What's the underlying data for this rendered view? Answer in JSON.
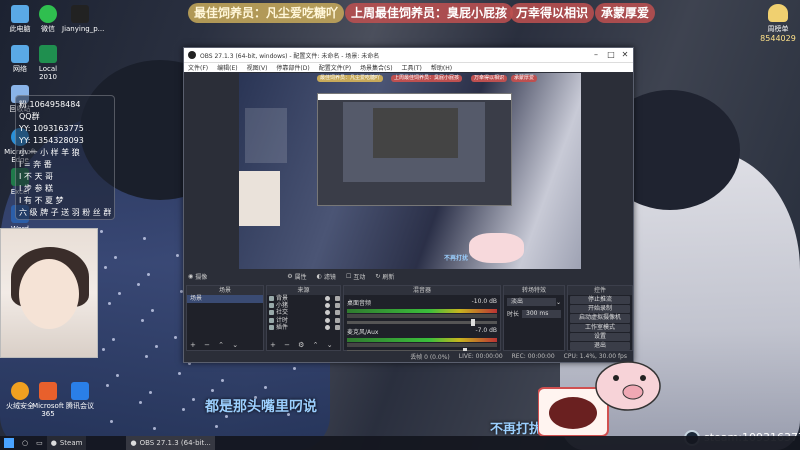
{
  "banners": {
    "best_feeder": "最佳饲养员：凡尘爱吃糖吖",
    "last_week": "上周最佳饲养员：臭屁小屁孩",
    "thanks": "万幸得以相识",
    "grateful": "承蒙厚爱"
  },
  "desktop_icons": [
    {
      "label": "此电脑",
      "color": "#5aa9e6"
    },
    {
      "label": "微信",
      "color": "#2fbf4f"
    },
    {
      "label": "Jianying_p...",
      "color": "#222222"
    },
    {
      "label": "网络",
      "color": "#5aa9e6"
    },
    {
      "label": "Local 2010",
      "color": "#1f8f4f"
    },
    {
      "label": "回收站",
      "color": "#8ab4e8"
    },
    {
      "label": "Microsoft Edge",
      "color": "#2a8fd8"
    },
    {
      "label": "Excel",
      "color": "#1f7a4a"
    },
    {
      "label": "Word",
      "color": "#2b5ea8"
    },
    {
      "label": "火绒安全",
      "color": "#f0a020"
    },
    {
      "label": "Microsoft 365",
      "color": "#e8602c"
    },
    {
      "label": "腾讯会议",
      "color": "#2a7fe8"
    }
  ],
  "fans_panel": [
    "粉 1064958484",
    "QQ群",
    "YY: 1093163775",
    "YY: 1354328093",
    "小 一 小 样 羊 狼",
    "I  =  奔 番",
    "I  不  天 哥",
    "I  步  参 糕",
    "I  有 不 夏 梦",
    "六 级 牌 子 送 羽 粉 丝 群"
  ],
  "subtitles": {
    "main": "都是那头嘴里叼说",
    "pig": "不再打扰"
  },
  "rank_badge": {
    "label": "周榜单",
    "number": "8544029"
  },
  "steam_label": "steam:1093163775",
  "taskbar": {
    "steam": "Steam",
    "obs": "OBS 27.1.3 (64-bit..."
  },
  "obs": {
    "title": "OBS 27.1.3 (64-bit, windows) - 配置文件: 未命名 - 场景: 未命名",
    "menus": [
      "文件(F)",
      "编辑(E)",
      "视图(V)",
      "停靠部件(D)",
      "配置文件(P)",
      "场景集合(S)",
      "工具(T)",
      "帮助(H)"
    ],
    "preview_banners": [
      "最佳饲养员：凡尘爱吃糖吖",
      "上周最佳饲养员：臭屁小屁孩",
      "万幸得以相识",
      "承蒙厚爱"
    ],
    "preview_sub": "不再打扰",
    "strip": {
      "scene": "摄像",
      "props": "属性",
      "filters": "滤镜",
      "interact": "互动",
      "refresh": "刷新"
    },
    "docks": {
      "scenes_title": "场景",
      "sources_title": "来源",
      "mixer_title": "混音器",
      "trans_title": "转场特效",
      "controls_title": "控件"
    },
    "scenes": [
      "场景"
    ],
    "sources": [
      "背景",
      "小猪",
      "社交",
      "计时",
      "插件"
    ],
    "mixer": [
      {
        "name": "桌面音频",
        "db": "-10.0 dB",
        "level": 0.85
      },
      {
        "name": "麦克风/Aux",
        "db": "-7.0 dB",
        "level": 0.8
      }
    ],
    "transition": {
      "type": "淡出",
      "duration_label": "时长",
      "duration": "300 ms"
    },
    "controls": [
      "停止推流",
      "开始录制",
      "启动虚拟摄像机",
      "工作室模式",
      "设置",
      "退出"
    ],
    "status": {
      "dropped": "丢帧 0 (0.0%)",
      "live": "LIVE: 00:00:00",
      "rec": "REC: 00:00:00",
      "cpu": "CPU: 1.4%, 30.00 fps"
    }
  }
}
